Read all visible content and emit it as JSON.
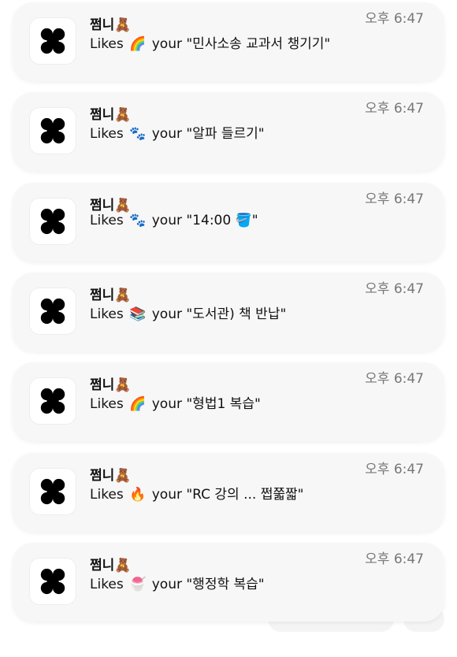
{
  "notifications": [
    {
      "sender": "쩜니🧸",
      "action": "Likes",
      "reaction": "🌈",
      "text": "your \"민사소송 교과서 챙기기\"",
      "time": "오후 6:47"
    },
    {
      "sender": "쩜니🧸",
      "action": "Likes",
      "reaction": "🐾",
      "text": "your \"알파 들르기\"",
      "time": "오후 6:47"
    },
    {
      "sender": "쩜니🧸",
      "action": "Likes",
      "reaction": "🐾",
      "text": "your \"14:00 🪣\"",
      "time": "오후 6:47"
    },
    {
      "sender": "쩜니🧸",
      "action": "Likes",
      "reaction": "📚",
      "text": "your \"도서관) 책 반납\"",
      "time": "오후 6:47"
    },
    {
      "sender": "쩜니🧸",
      "action": "Likes",
      "reaction": "🌈",
      "text": "your \"형법1 복습\"",
      "time": "오후 6:47"
    },
    {
      "sender": "쩜니🧸",
      "action": "Likes",
      "reaction": "🔥",
      "text": "your \"RC 강의 ... 쩝쭓짧\"",
      "time": "오후 6:47"
    },
    {
      "sender": "쩜니🧸",
      "action": "Likes",
      "reaction": "🍧",
      "text": "your \"행정학 복습\"",
      "time": "오후 6:47"
    }
  ],
  "icons": {
    "app_icon": "app-logo-icon"
  }
}
